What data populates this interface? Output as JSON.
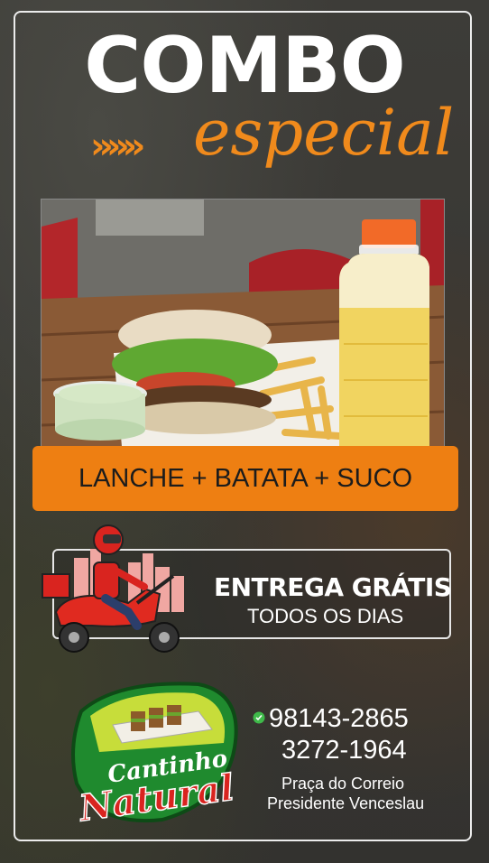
{
  "title": {
    "combo": "COMBO",
    "especial": "especial",
    "chevrons": "»»»"
  },
  "offer": {
    "text": "LANCHE + BATATA + SUCO"
  },
  "delivery": {
    "headline": "ENTREGA GRÁTIS",
    "subline": "TODOS OS DIAS"
  },
  "brand": {
    "name_line1": "Cantinho",
    "name_line2": "Natural"
  },
  "contact": {
    "phone_whatsapp": "98143-2865",
    "phone": "3272-1964",
    "address_line1": "Praça do Correio",
    "address_line2": "Presidente Venceslau"
  },
  "colors": {
    "accent": "#ee7f12",
    "text": "#ffffff",
    "background": "#3a3935",
    "logo_green": "#1f8a2e",
    "logo_red": "#c8201f"
  },
  "icons": {
    "whatsapp": "whatsapp-icon",
    "scooter": "delivery-scooter-icon",
    "chevrons": "chevron-right-icon"
  }
}
